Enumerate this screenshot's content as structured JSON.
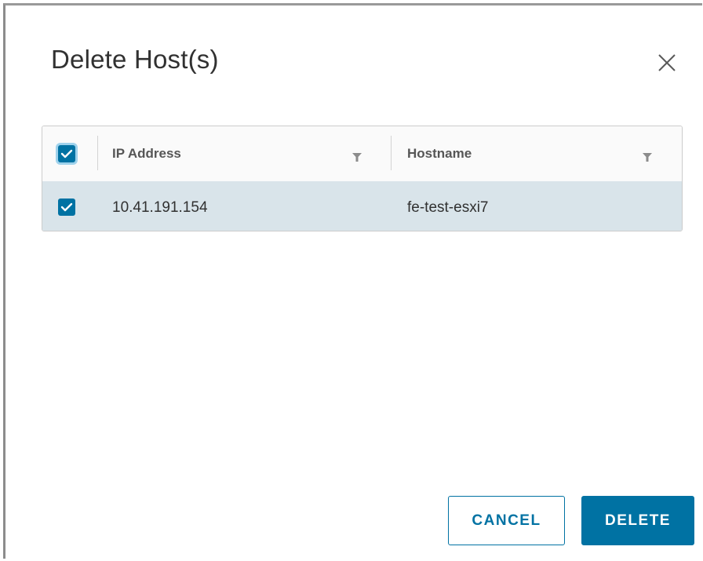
{
  "dialog": {
    "title": "Delete Host(s)"
  },
  "grid": {
    "columns": [
      {
        "label": "IP Address"
      },
      {
        "label": "Hostname"
      }
    ],
    "rows": [
      {
        "ip": "10.41.191.154",
        "hostname": "fe-test-esxi7",
        "selected": true
      }
    ],
    "select_all_checked": true
  },
  "footer": {
    "cancel_label": "CANCEL",
    "delete_label": "DELETE"
  },
  "colors": {
    "primary": "#0072a3",
    "selected_row": "#d9e4ea"
  },
  "icons": {
    "close": "close-icon",
    "filter": "filter-icon",
    "check": "check-icon"
  }
}
